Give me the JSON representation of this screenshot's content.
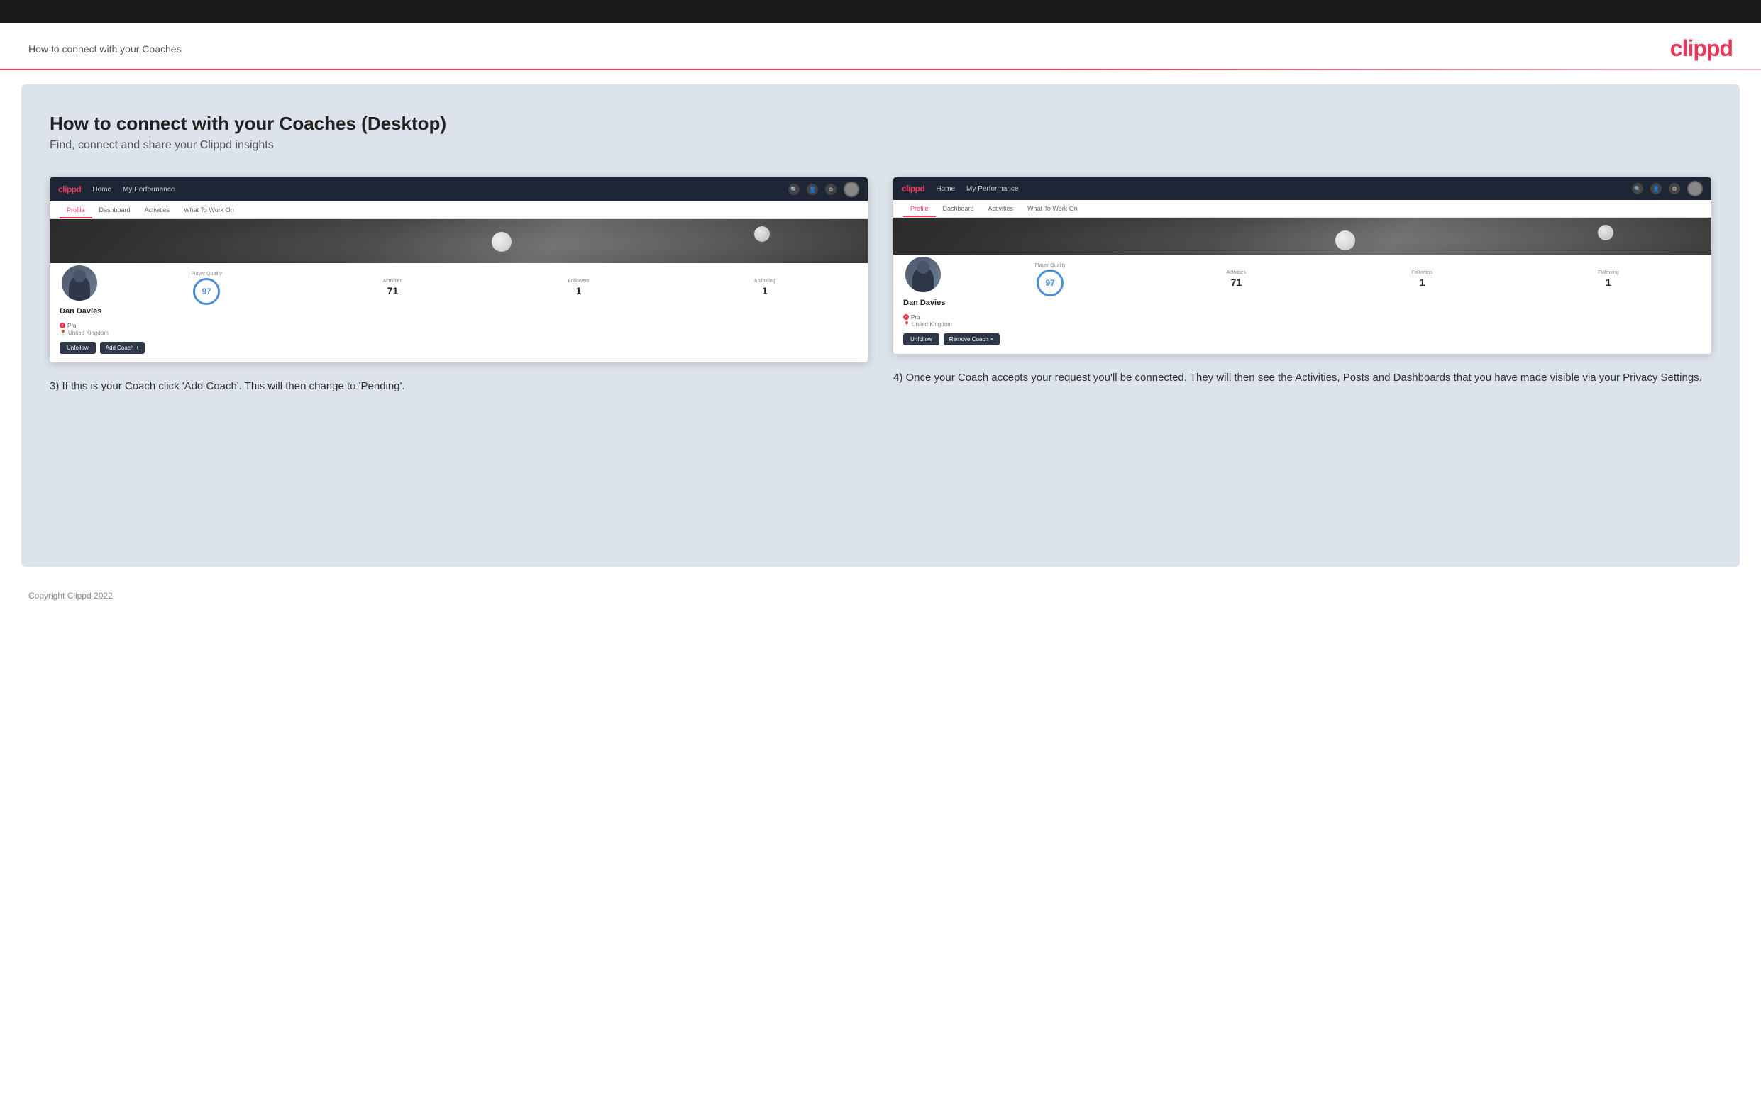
{
  "topbar": {},
  "header": {
    "title": "How to connect with your Coaches",
    "logo": "clippd"
  },
  "main": {
    "heading": "How to connect with your Coaches (Desktop)",
    "subheading": "Find, connect and share your Clippd insights",
    "panels": [
      {
        "id": "panel-left",
        "nav": {
          "logo": "clippd",
          "items": [
            "Home",
            "My Performance"
          ]
        },
        "tabs": [
          "Profile",
          "Dashboard",
          "Activities",
          "What To Work On"
        ],
        "active_tab": "Profile",
        "profile": {
          "name": "Dan Davies",
          "badge": "Pro",
          "location": "United Kingdom",
          "player_quality_label": "Player Quality",
          "player_quality_value": "97",
          "activities_label": "Activities",
          "activities_value": "71",
          "followers_label": "Followers",
          "followers_value": "1",
          "following_label": "Following",
          "following_value": "1"
        },
        "buttons": [
          "Unfollow",
          "Add Coach +"
        ],
        "description": "3) If this is your Coach click 'Add Coach'. This will then change to 'Pending'."
      },
      {
        "id": "panel-right",
        "nav": {
          "logo": "clippd",
          "items": [
            "Home",
            "My Performance"
          ]
        },
        "tabs": [
          "Profile",
          "Dashboard",
          "Activities",
          "What To Work On"
        ],
        "active_tab": "Profile",
        "profile": {
          "name": "Dan Davies",
          "badge": "Pro",
          "location": "United Kingdom",
          "player_quality_label": "Player Quality",
          "player_quality_value": "97",
          "activities_label": "Activities",
          "activities_value": "71",
          "followers_label": "Followers",
          "followers_value": "1",
          "following_label": "Following",
          "following_value": "1"
        },
        "buttons": [
          "Unfollow",
          "Remove Coach ×"
        ],
        "description": "4) Once your Coach accepts your request you'll be connected. They will then see the Activities, Posts and Dashboards that you have made visible via your Privacy Settings."
      }
    ]
  },
  "footer": {
    "copyright": "Copyright Clippd 2022"
  }
}
